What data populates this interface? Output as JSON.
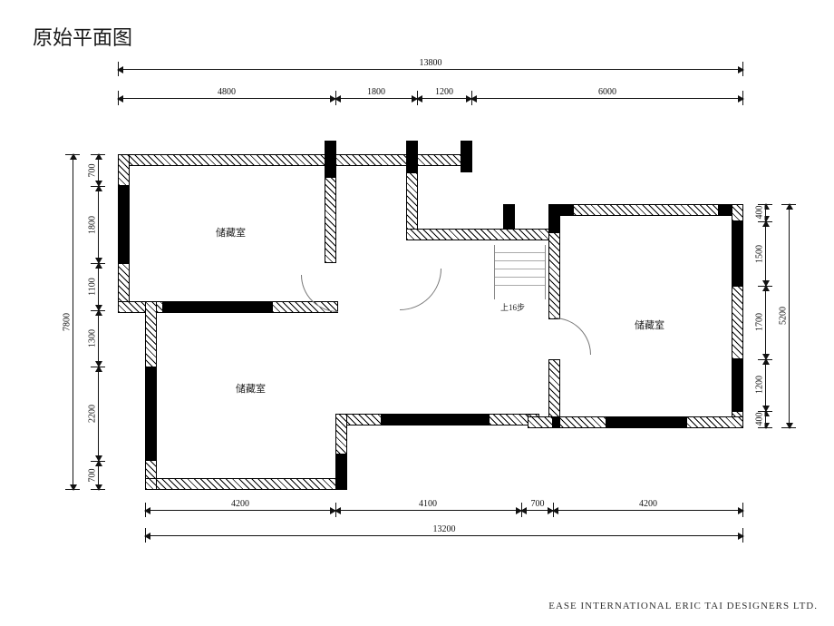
{
  "title": "原始平面图",
  "footer": "EASE INTERNATIONAL ERIC TAI DESIGNERS LTD.",
  "rooms": {
    "storage1": "储藏室",
    "storage2": "储藏室",
    "storage3": "储藏室",
    "stair": "上16步"
  },
  "dims": {
    "top_overall": "13800",
    "top_seg": [
      "4800",
      "1800",
      "1200",
      "6000"
    ],
    "bottom_overall": "13200",
    "bottom_seg": [
      "4200",
      "4100",
      "700",
      "4200"
    ],
    "left_overall": "7800",
    "left_seg": [
      "700",
      "1800",
      "1100",
      "1300",
      "2200",
      "700"
    ],
    "right_overall": "5200",
    "right_seg": [
      "400",
      "1500",
      "1700",
      "1200",
      "400"
    ]
  }
}
